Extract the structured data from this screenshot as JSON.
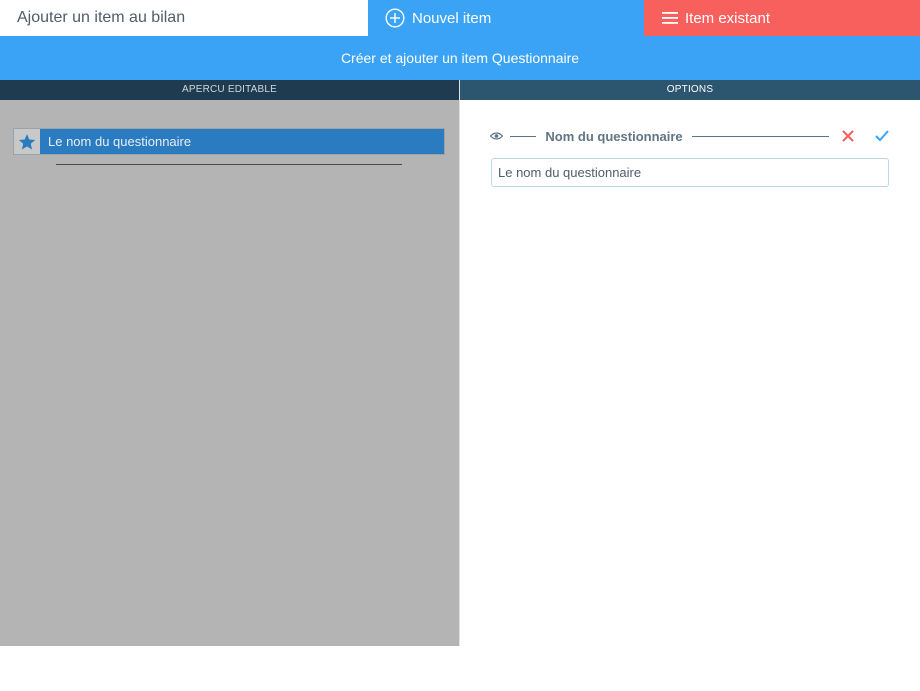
{
  "header": {
    "title": "Ajouter un item au bilan",
    "tab_new": "Nouvel item",
    "tab_existing": "Item existant"
  },
  "subheader": {
    "text": "Créer et ajouter un item Questionnaire"
  },
  "columns": {
    "left": "APERCU EDITABLE",
    "right": "OPTIONS"
  },
  "preview": {
    "item_label": "Le nom du questionnaire"
  },
  "options": {
    "field_label": "Nom du questionnaire",
    "field_value": "Le nom du questionnaire"
  },
  "colors": {
    "blue": "#3aa3f5",
    "red": "#f7605d",
    "navy": "#1e3b50",
    "steel": "#2c5670",
    "preview_bg": "#b4b4b4",
    "preview_item": "#2a7bc0"
  },
  "icons": {
    "tab_new": "plus-circle-icon",
    "tab_existing": "menu-icon",
    "preview_item": "star-icon",
    "field_visibility": "eye-icon",
    "cancel": "close-icon",
    "confirm": "check-icon"
  }
}
